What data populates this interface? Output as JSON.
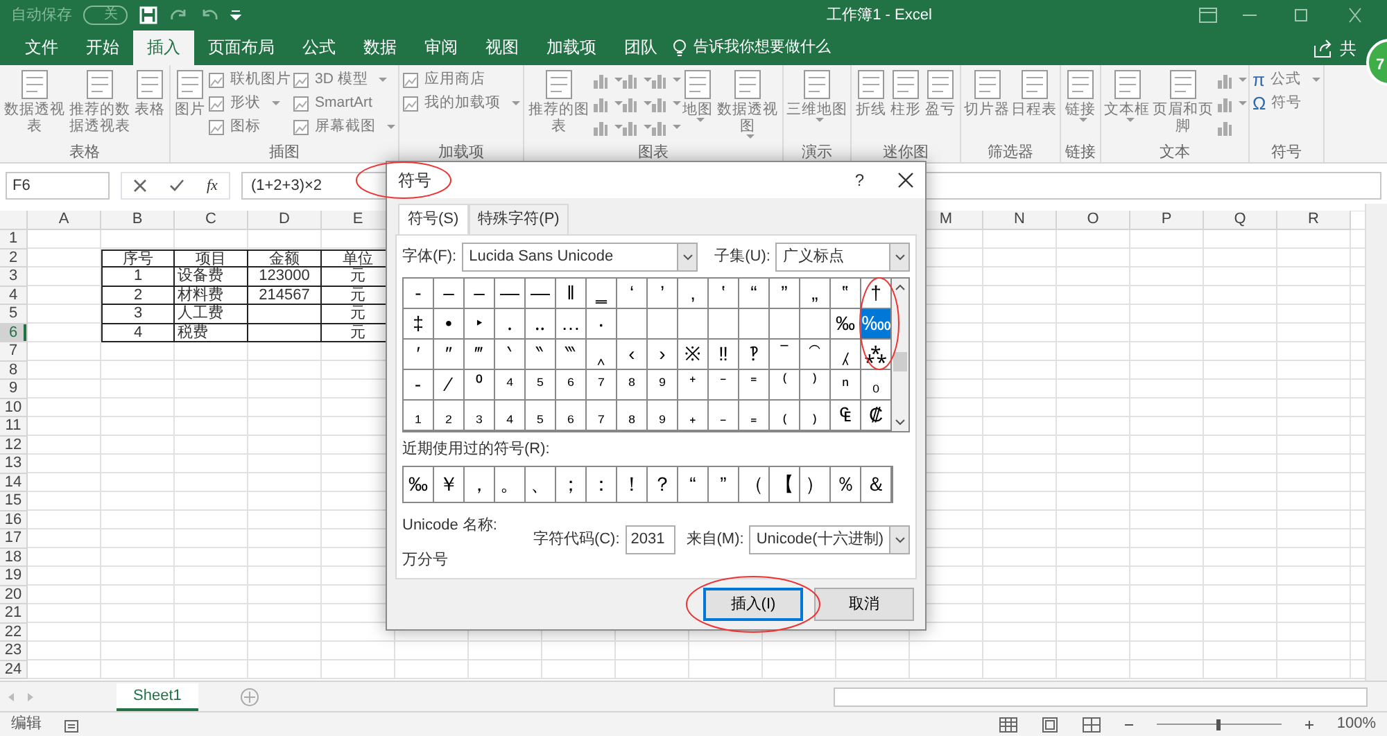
{
  "window": {
    "autosave": "自动保存",
    "autosave_state": "关",
    "title": "工作簿1 - Excel"
  },
  "tabs": [
    {
      "label": "文件",
      "selected": false
    },
    {
      "label": "开始",
      "selected": false
    },
    {
      "label": "插入",
      "selected": true
    },
    {
      "label": "页面布局",
      "selected": false
    },
    {
      "label": "公式",
      "selected": false
    },
    {
      "label": "数据",
      "selected": false
    },
    {
      "label": "审阅",
      "selected": false
    },
    {
      "label": "视图",
      "selected": false
    },
    {
      "label": "加载项",
      "selected": false
    },
    {
      "label": "团队",
      "selected": false
    }
  ],
  "tell_me": "告诉我你想要做什么",
  "share": "共",
  "badge": "7",
  "ribbon": [
    {
      "label": "表格",
      "items": [
        {
          "kind": "large",
          "label": "数据透视表",
          "dropdown": false
        },
        {
          "kind": "large",
          "label": "推荐的数据透视表",
          "dropdown": false
        },
        {
          "kind": "large",
          "label": "表格",
          "dropdown": false
        }
      ]
    },
    {
      "label": "插图",
      "items": [
        {
          "kind": "large",
          "label": "图片",
          "dropdown": false
        },
        {
          "kind": "stack",
          "items": [
            {
              "label": "联机图片",
              "dropdown": false
            },
            {
              "label": "形状",
              "dropdown": true
            },
            {
              "label": "图标",
              "dropdown": false
            }
          ]
        },
        {
          "kind": "stack",
          "items": [
            {
              "label": "3D 模型",
              "dropdown": true
            },
            {
              "label": "SmartArt",
              "dropdown": false
            },
            {
              "label": "屏幕截图",
              "dropdown": true
            }
          ]
        }
      ]
    },
    {
      "label": "加载项",
      "items": [
        {
          "kind": "stack",
          "items": [
            {
              "label": "应用商店",
              "dropdown": false
            },
            {
              "label": "我的加载项",
              "dropdown": true
            }
          ]
        }
      ]
    },
    {
      "label": "图表",
      "items": [
        {
          "kind": "large",
          "label": "推荐的图表",
          "dropdown": false
        },
        {
          "kind": "grid",
          "items": [
            {
              "dropdown": true
            },
            {
              "dropdown": true
            },
            {
              "dropdown": true
            },
            {
              "dropdown": true
            },
            {
              "dropdown": true
            },
            {
              "dropdown": true
            },
            {
              "dropdown": true
            },
            {
              "dropdown": true
            },
            {
              "dropdown": true
            }
          ]
        },
        {
          "kind": "large",
          "label": "地图",
          "dropdown": true
        },
        {
          "kind": "large",
          "label": "数据透视图",
          "dropdown": true
        }
      ]
    },
    {
      "label": "演示",
      "items": [
        {
          "kind": "large",
          "label": "三维地图",
          "dropdown": true
        }
      ]
    },
    {
      "label": "迷你图",
      "items": [
        {
          "kind": "large",
          "label": "折线",
          "dropdown": false
        },
        {
          "kind": "large",
          "label": "柱形",
          "dropdown": false
        },
        {
          "kind": "large",
          "label": "盈亏",
          "dropdown": false
        }
      ]
    },
    {
      "label": "筛选器",
      "items": [
        {
          "kind": "large",
          "label": "切片器",
          "dropdown": false
        },
        {
          "kind": "large",
          "label": "日程表",
          "dropdown": false
        }
      ]
    },
    {
      "label": "链接",
      "items": [
        {
          "kind": "large",
          "label": "链接",
          "dropdown": true
        }
      ]
    },
    {
      "label": "文本",
      "items": [
        {
          "kind": "large",
          "label": "文本框",
          "dropdown": true
        },
        {
          "kind": "large",
          "label": "页眉和页脚",
          "dropdown": false
        },
        {
          "kind": "grid",
          "items": [
            {
              "dropdown": true
            },
            {
              "dropdown": true
            },
            {
              "dropdown": false
            }
          ]
        }
      ]
    },
    {
      "label": "符号",
      "items": [
        {
          "kind": "stack",
          "items": [
            {
              "glyph": "π",
              "label": "公式",
              "dropdown": true
            },
            {
              "glyph": "Ω",
              "label": "符号",
              "dropdown": false
            }
          ]
        }
      ]
    }
  ],
  "formula_bar": {
    "name_box": "F6",
    "function_label": "fx",
    "formula": "(1+2+3)×2"
  },
  "sheet": {
    "columns_left": [
      "A",
      "B",
      "C",
      "D",
      "E"
    ],
    "columns_right": [
      "M",
      "N",
      "O",
      "P",
      "Q",
      "R"
    ],
    "rows": [
      {
        "label": "1",
        "selected": false
      },
      {
        "label": "2",
        "selected": false
      },
      {
        "label": "3",
        "selected": false
      },
      {
        "label": "4",
        "selected": false
      },
      {
        "label": "5",
        "selected": false
      },
      {
        "label": "6",
        "selected": true
      },
      {
        "label": "7",
        "selected": false
      },
      {
        "label": "8",
        "selected": false
      },
      {
        "label": "9",
        "selected": false
      },
      {
        "label": "10",
        "selected": false
      },
      {
        "label": "11",
        "selected": false
      },
      {
        "label": "12",
        "selected": false
      },
      {
        "label": "13",
        "selected": false
      },
      {
        "label": "14",
        "selected": false
      },
      {
        "label": "15",
        "selected": false
      },
      {
        "label": "16",
        "selected": false
      },
      {
        "label": "17",
        "selected": false
      },
      {
        "label": "18",
        "selected": false
      },
      {
        "label": "19",
        "selected": false
      },
      {
        "label": "20",
        "selected": false
      },
      {
        "label": "21",
        "selected": false
      },
      {
        "label": "22",
        "selected": false
      },
      {
        "label": "23",
        "selected": false
      },
      {
        "label": "24",
        "selected": false
      }
    ],
    "table": {
      "header": [
        "序号",
        "项目",
        "金额",
        "单位"
      ],
      "rows": [
        {
          "no": "1",
          "item": "设备费",
          "amount": "123000",
          "unit": "元"
        },
        {
          "no": "2",
          "item": "材料费",
          "amount": "214567",
          "unit": "元"
        },
        {
          "no": "3",
          "item": "人工费",
          "unit": "元"
        },
        {
          "no": "4",
          "item": "税费",
          "unit": "元"
        }
      ]
    }
  },
  "sheet_tabs": [
    {
      "label": "Sheet1",
      "selected": true
    }
  ],
  "status_bar": {
    "mode": "编辑",
    "zoom_slider": {
      "level": 0.5
    },
    "zoom": "100%"
  },
  "dialog": {
    "title": "符号",
    "help": "?",
    "tabs": [
      {
        "label": "符号(S)",
        "selected": true
      },
      {
        "label": "特殊字符(P)",
        "selected": false
      }
    ],
    "font_label": "字体(F):",
    "font": "Lucida Sans Unicode",
    "subset_label": "子集(U):",
    "subset": "广义标点",
    "symbols": [
      [
        {
          "char": "‑",
          "selected": false
        },
        {
          "char": "‒",
          "selected": false
        },
        {
          "char": "–",
          "selected": false
        },
        {
          "char": "—",
          "selected": false
        },
        {
          "char": "―",
          "selected": false
        },
        {
          "char": "‖",
          "selected": false
        },
        {
          "char": "‗",
          "selected": false
        },
        {
          "char": "‘",
          "selected": false
        },
        {
          "char": "’",
          "selected": false
        },
        {
          "char": "‚",
          "selected": false
        },
        {
          "char": "‛",
          "selected": false
        },
        {
          "char": "“",
          "selected": false
        },
        {
          "char": "”",
          "selected": false
        },
        {
          "char": "„",
          "selected": false
        },
        {
          "char": "‟",
          "selected": false
        },
        {
          "char": "†",
          "selected": false
        }
      ],
      [
        {
          "char": "‡",
          "selected": false
        },
        {
          "char": "•",
          "selected": false
        },
        {
          "char": "‣",
          "selected": false
        },
        {
          "char": "․",
          "selected": false
        },
        {
          "char": "‥",
          "selected": false
        },
        {
          "char": "…",
          "selected": false
        },
        {
          "char": "‧",
          "selected": false
        },
        {
          "selected": false
        },
        {
          "selected": false
        },
        {
          "selected": false
        },
        {
          "selected": false
        },
        {
          "selected": false
        },
        {
          "selected": false
        },
        {
          "selected": false
        },
        {
          "char": "‰",
          "selected": false
        },
        {
          "char": "‱",
          "selected": true
        }
      ],
      [
        {
          "char": "′",
          "selected": false
        },
        {
          "char": "″",
          "selected": false
        },
        {
          "char": "‴",
          "selected": false
        },
        {
          "char": "‵",
          "selected": false
        },
        {
          "char": "‶",
          "selected": false
        },
        {
          "char": "‷",
          "selected": false
        },
        {
          "char": "‸",
          "selected": false
        },
        {
          "char": "‹",
          "selected": false
        },
        {
          "char": "›",
          "selected": false
        },
        {
          "char": "※",
          "selected": false
        },
        {
          "char": "‼",
          "selected": false
        },
        {
          "char": "‽",
          "selected": false
        },
        {
          "char": "‾",
          "selected": false
        },
        {
          "char": "⁀",
          "selected": false
        },
        {
          "char": "⁁",
          "selected": false
        },
        {
          "char": "⁂",
          "selected": false
        }
      ],
      [
        {
          "char": "⁃",
          "selected": false
        },
        {
          "char": "⁄",
          "selected": false
        },
        {
          "char": "⁰",
          "selected": false
        },
        {
          "char": "⁴",
          "selected": false
        },
        {
          "char": "⁵",
          "selected": false
        },
        {
          "char": "⁶",
          "selected": false
        },
        {
          "char": "⁷",
          "selected": false
        },
        {
          "char": "⁸",
          "selected": false
        },
        {
          "char": "⁹",
          "selected": false
        },
        {
          "char": "⁺",
          "selected": false
        },
        {
          "char": "⁻",
          "selected": false
        },
        {
          "char": "⁼",
          "selected": false
        },
        {
          "char": "⁽",
          "selected": false
        },
        {
          "char": "⁾",
          "selected": false
        },
        {
          "char": "ⁿ",
          "selected": false
        },
        {
          "char": "₀",
          "selected": false
        }
      ],
      [
        {
          "char": "₁",
          "selected": false
        },
        {
          "char": "₂",
          "selected": false
        },
        {
          "char": "₃",
          "selected": false
        },
        {
          "char": "₄",
          "selected": false
        },
        {
          "char": "₅",
          "selected": false
        },
        {
          "char": "₆",
          "selected": false
        },
        {
          "char": "₇",
          "selected": false
        },
        {
          "char": "₈",
          "selected": false
        },
        {
          "char": "₉",
          "selected": false
        },
        {
          "char": "₊",
          "selected": false
        },
        {
          "char": "₋",
          "selected": false
        },
        {
          "char": "₌",
          "selected": false
        },
        {
          "char": "₍",
          "selected": false
        },
        {
          "char": "₎",
          "selected": false
        },
        {
          "char": "₠",
          "selected": false
        },
        {
          "char": "₡",
          "selected": false
        }
      ]
    ],
    "recent_label": "近期使用过的符号(R):",
    "recent": [
      "‰",
      "￥",
      "，",
      "。",
      "、",
      "；",
      "：",
      "！",
      "？",
      "“",
      "”",
      "（",
      "【",
      "）",
      "％",
      "＆"
    ],
    "unicode_name_label": "Unicode 名称:",
    "unicode_name": "万分号",
    "code_label": "字符代码(C):",
    "code": "2031",
    "from_label": "来自(M):",
    "from": "Unicode(十六进制)",
    "buttons": [
      {
        "label": "插入(I)",
        "default": true
      },
      {
        "label": "取消",
        "default": false
      }
    ]
  }
}
